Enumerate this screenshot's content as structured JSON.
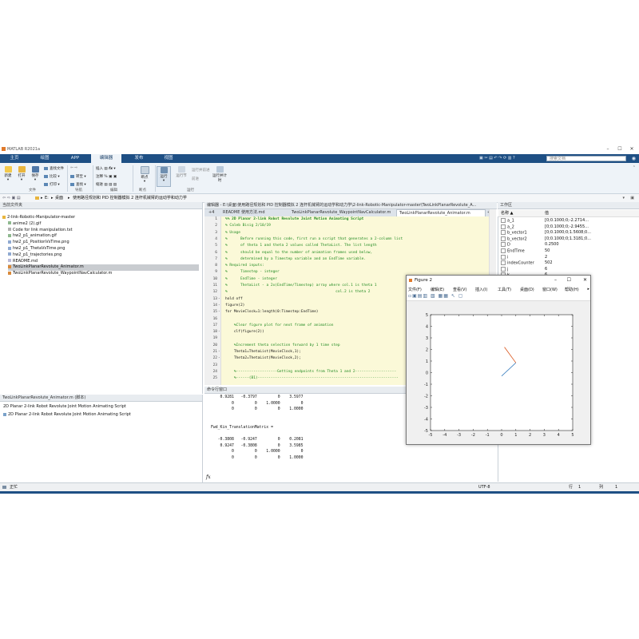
{
  "app": {
    "title": "MATLAB R2021a"
  },
  "search": {
    "placeholder": "搜索文档"
  },
  "main_tabs": [
    "主页",
    "绘图",
    "APP",
    "编辑器",
    "发布",
    "视图"
  ],
  "ribbon": {
    "new": "新建",
    "open": "打开",
    "save": "保存",
    "find_files": "查找文件",
    "compare": "比较",
    "print": "打印",
    "goto": "转至",
    "find": "查找",
    "insert": "插入",
    "comment": "注释",
    "indent": "缩进",
    "breakpoints": "断点",
    "run": "运行",
    "run_section": "运行节",
    "advance": "前进",
    "run_and_advance": "运行并前进",
    "run_and_time": "运行并计时",
    "groups": [
      "文件",
      "导航",
      "编辑",
      "断点",
      "运行"
    ]
  },
  "addressbar": {
    "path": [
      "E:",
      "桌面",
      "使用路径规划和 PID 控制器模拟 2 连杆机械臂的运动学和动力学"
    ]
  },
  "current_folder": {
    "title": "当前文件夹",
    "items": [
      {
        "name": "2-link-Robotic-Manipulator-master",
        "kind": "folder"
      },
      {
        "name": "anime2 (2).gif",
        "kind": "gif"
      },
      {
        "name": "Code for link manipulation.txt",
        "kind": "txt"
      },
      {
        "name": "hw2_p1_animation.gif",
        "kind": "gif"
      },
      {
        "name": "hw2_p1_PositionVsTime.png",
        "kind": "png"
      },
      {
        "name": "hw2_p1_ThetaVsTime.png",
        "kind": "png"
      },
      {
        "name": "hw2_p1_trajectories.png",
        "kind": "png"
      },
      {
        "name": "README.md",
        "kind": "md"
      },
      {
        "name": "TwoLinkPlanarRevolute_Animator.m",
        "kind": "m",
        "selected": true
      },
      {
        "name": "TwoLinkPlanarRevolute_WaypointNavCalculator.m",
        "kind": "m"
      }
    ]
  },
  "details": {
    "title": "TwoLinkPlanarRevolute_Animator.m (脚本)",
    "line1": "2D Planar 2-link Robot Revolute Joint Motion Animating Script",
    "line2": "2D Planar 2-link Robot Revolute Joint Motion Animating Script"
  },
  "editor": {
    "path": "编辑器 - E:\\桌面\\使用路径规划和 PID 控制器模拟 2 连杆机械臂的运动学和动力学\\2-link-Robotic-Manipulator-master\\TwoLinkPlanarRevolute_A...",
    "tabs": [
      "+4",
      "README 使用方法.md",
      "TwoLinkPlanarRevolute_WaypointNavCalculator.m",
      "TwoLinkPlanarRevolute_Animator.m"
    ],
    "lines": [
      {
        "n": "1",
        "d": "",
        "t": "%% 2D Planar 2-link Robot Revolute Joint Motion Animating Script",
        "c": "cmt"
      },
      {
        "n": "2",
        "d": "",
        "t": "% Caleb Bisig 2/10/19",
        "c": "cmt"
      },
      {
        "n": "3",
        "d": "",
        "t": "% Usage",
        "c": "cmt"
      },
      {
        "n": "4",
        "d": "",
        "t": "%      Before running this code, first run a script that generates a 2-column list",
        "c": "cmt"
      },
      {
        "n": "5",
        "d": "",
        "t": "%      of theta 1 and theta 2 values called ThetaList. The list length",
        "c": "cmt"
      },
      {
        "n": "6",
        "d": "",
        "t": "%      should be equal to the number of animation frames used below,",
        "c": "cmt"
      },
      {
        "n": "7",
        "d": "",
        "t": "%      determined by a Timestep variable and an EndTime variable.",
        "c": "cmt"
      },
      {
        "n": "8",
        "d": "",
        "t": "% Required inputs:",
        "c": "cmt"
      },
      {
        "n": "9",
        "d": "",
        "t": "%      Timestep - integer",
        "c": "cmt"
      },
      {
        "n": "10",
        "d": "",
        "t": "%      EndTime - integer",
        "c": "cmt"
      },
      {
        "n": "11",
        "d": "",
        "t": "%      ThetaList - a 2x(EndTime/Timestep) array where col.1 is theta 1",
        "c": "cmt"
      },
      {
        "n": "12",
        "d": "",
        "t": "%                                                  col.2 is theta 2",
        "c": "cmt"
      },
      {
        "n": "13",
        "d": "-",
        "t": "hold off",
        "c": ""
      },
      {
        "n": "14",
        "d": "-",
        "t": "figure(2)",
        "c": ""
      },
      {
        "n": "15",
        "d": "-",
        "t": "for MovieClock=1:length(0:Timestep:EndTime)",
        "c": "kwline"
      },
      {
        "n": "16",
        "d": "",
        "t": "",
        "c": ""
      },
      {
        "n": "17",
        "d": "",
        "t": "    %Clear figure plot for next frame of animation",
        "c": "cmt"
      },
      {
        "n": "18",
        "d": "-",
        "t": "    clf(figure(2))",
        "c": ""
      },
      {
        "n": "19",
        "d": "",
        "t": "",
        "c": ""
      },
      {
        "n": "20",
        "d": "",
        "t": "    %Increment theta selection forward by 1 time step",
        "c": "cmt"
      },
      {
        "n": "21",
        "d": "-",
        "t": "    Theta1=ThetaList(MovieClock,1);",
        "c": ""
      },
      {
        "n": "22",
        "d": "-",
        "t": "    Theta2=ThetaList(MovieClock,2);",
        "c": ""
      },
      {
        "n": "23",
        "d": "",
        "t": "",
        "c": ""
      },
      {
        "n": "24",
        "d": "",
        "t": "    %-------------------Getting endpoints from Theta 1 and 2-------------------",
        "c": "cmt"
      },
      {
        "n": "25",
        "d": "",
        "t": "    %------(B1)-----------------------------------------------------------------",
        "c": "cmt"
      }
    ]
  },
  "command_window": {
    "title": "命令行窗口",
    "lines": [
      "    0.9281   -0.3797         0    3.5977",
      "         0         0    1.0000         0",
      "         0         0         0    1.0000",
      "",
      "",
      "Fwd_Kin_TranslationMatrix =",
      "",
      "   -0.3808   -0.9247         0    0.2081",
      "    0.9247   -0.3808         0    3.5985",
      "         0         0    1.0000         0",
      "         0         0         0    1.0000"
    ],
    "prompt": "fx"
  },
  "workspace": {
    "title": "工作区",
    "col_name": "名称 ▲",
    "col_value": "值",
    "vars": [
      {
        "name": "a_1",
        "value": "[0;0.1000;0;-2.2714..."
      },
      {
        "name": "a_2",
        "value": "[0;0.1000;0;-2.9455..."
      },
      {
        "name": "b_vector1",
        "value": "[0;0.1000;0;1.5608;0..."
      },
      {
        "name": "b_vector2",
        "value": "[0;0.1000;0;1.3181;0..."
      },
      {
        "name": "D",
        "value": "0.2500"
      },
      {
        "name": "EndTime",
        "value": "50"
      },
      {
        "name": "i",
        "value": "2"
      },
      {
        "name": "indexCounter",
        "value": "502"
      },
      {
        "name": "j",
        "value": "6"
      },
      {
        "name": "k",
        "value": "6"
      }
    ]
  },
  "figure": {
    "title": "Figure 2",
    "menu": [
      "文件(F)",
      "编辑(E)",
      "查看(V)",
      "插入(I)",
      "工具(T)",
      "桌面(D)",
      "窗口(W)",
      "帮助(H)"
    ],
    "chart_data": {
      "type": "line",
      "xlim": [
        -5,
        5
      ],
      "ylim": [
        -5,
        5
      ],
      "xticks": [
        "-5",
        "-4",
        "-3",
        "-2",
        "-1",
        "0",
        "1",
        "2",
        "3",
        "4",
        "5"
      ],
      "yticks": [
        "5",
        "4",
        "3",
        "2",
        "1",
        "0",
        "-1",
        "-2",
        "-3",
        "-4",
        "-5"
      ],
      "series": [
        {
          "x": [
            0,
            1
          ],
          "y": [
            -0.3,
            0.85
          ],
          "color": "#3a7fc0"
        },
        {
          "x": [
            1,
            0.2
          ],
          "y": [
            0.85,
            2.2
          ],
          "color": "#d95319"
        }
      ],
      "grid": false
    }
  },
  "status": {
    "left": "正忙",
    "encoding": "UTF-8",
    "ln_label": "行",
    "ln": "1",
    "col_label": "列",
    "col": "1"
  }
}
